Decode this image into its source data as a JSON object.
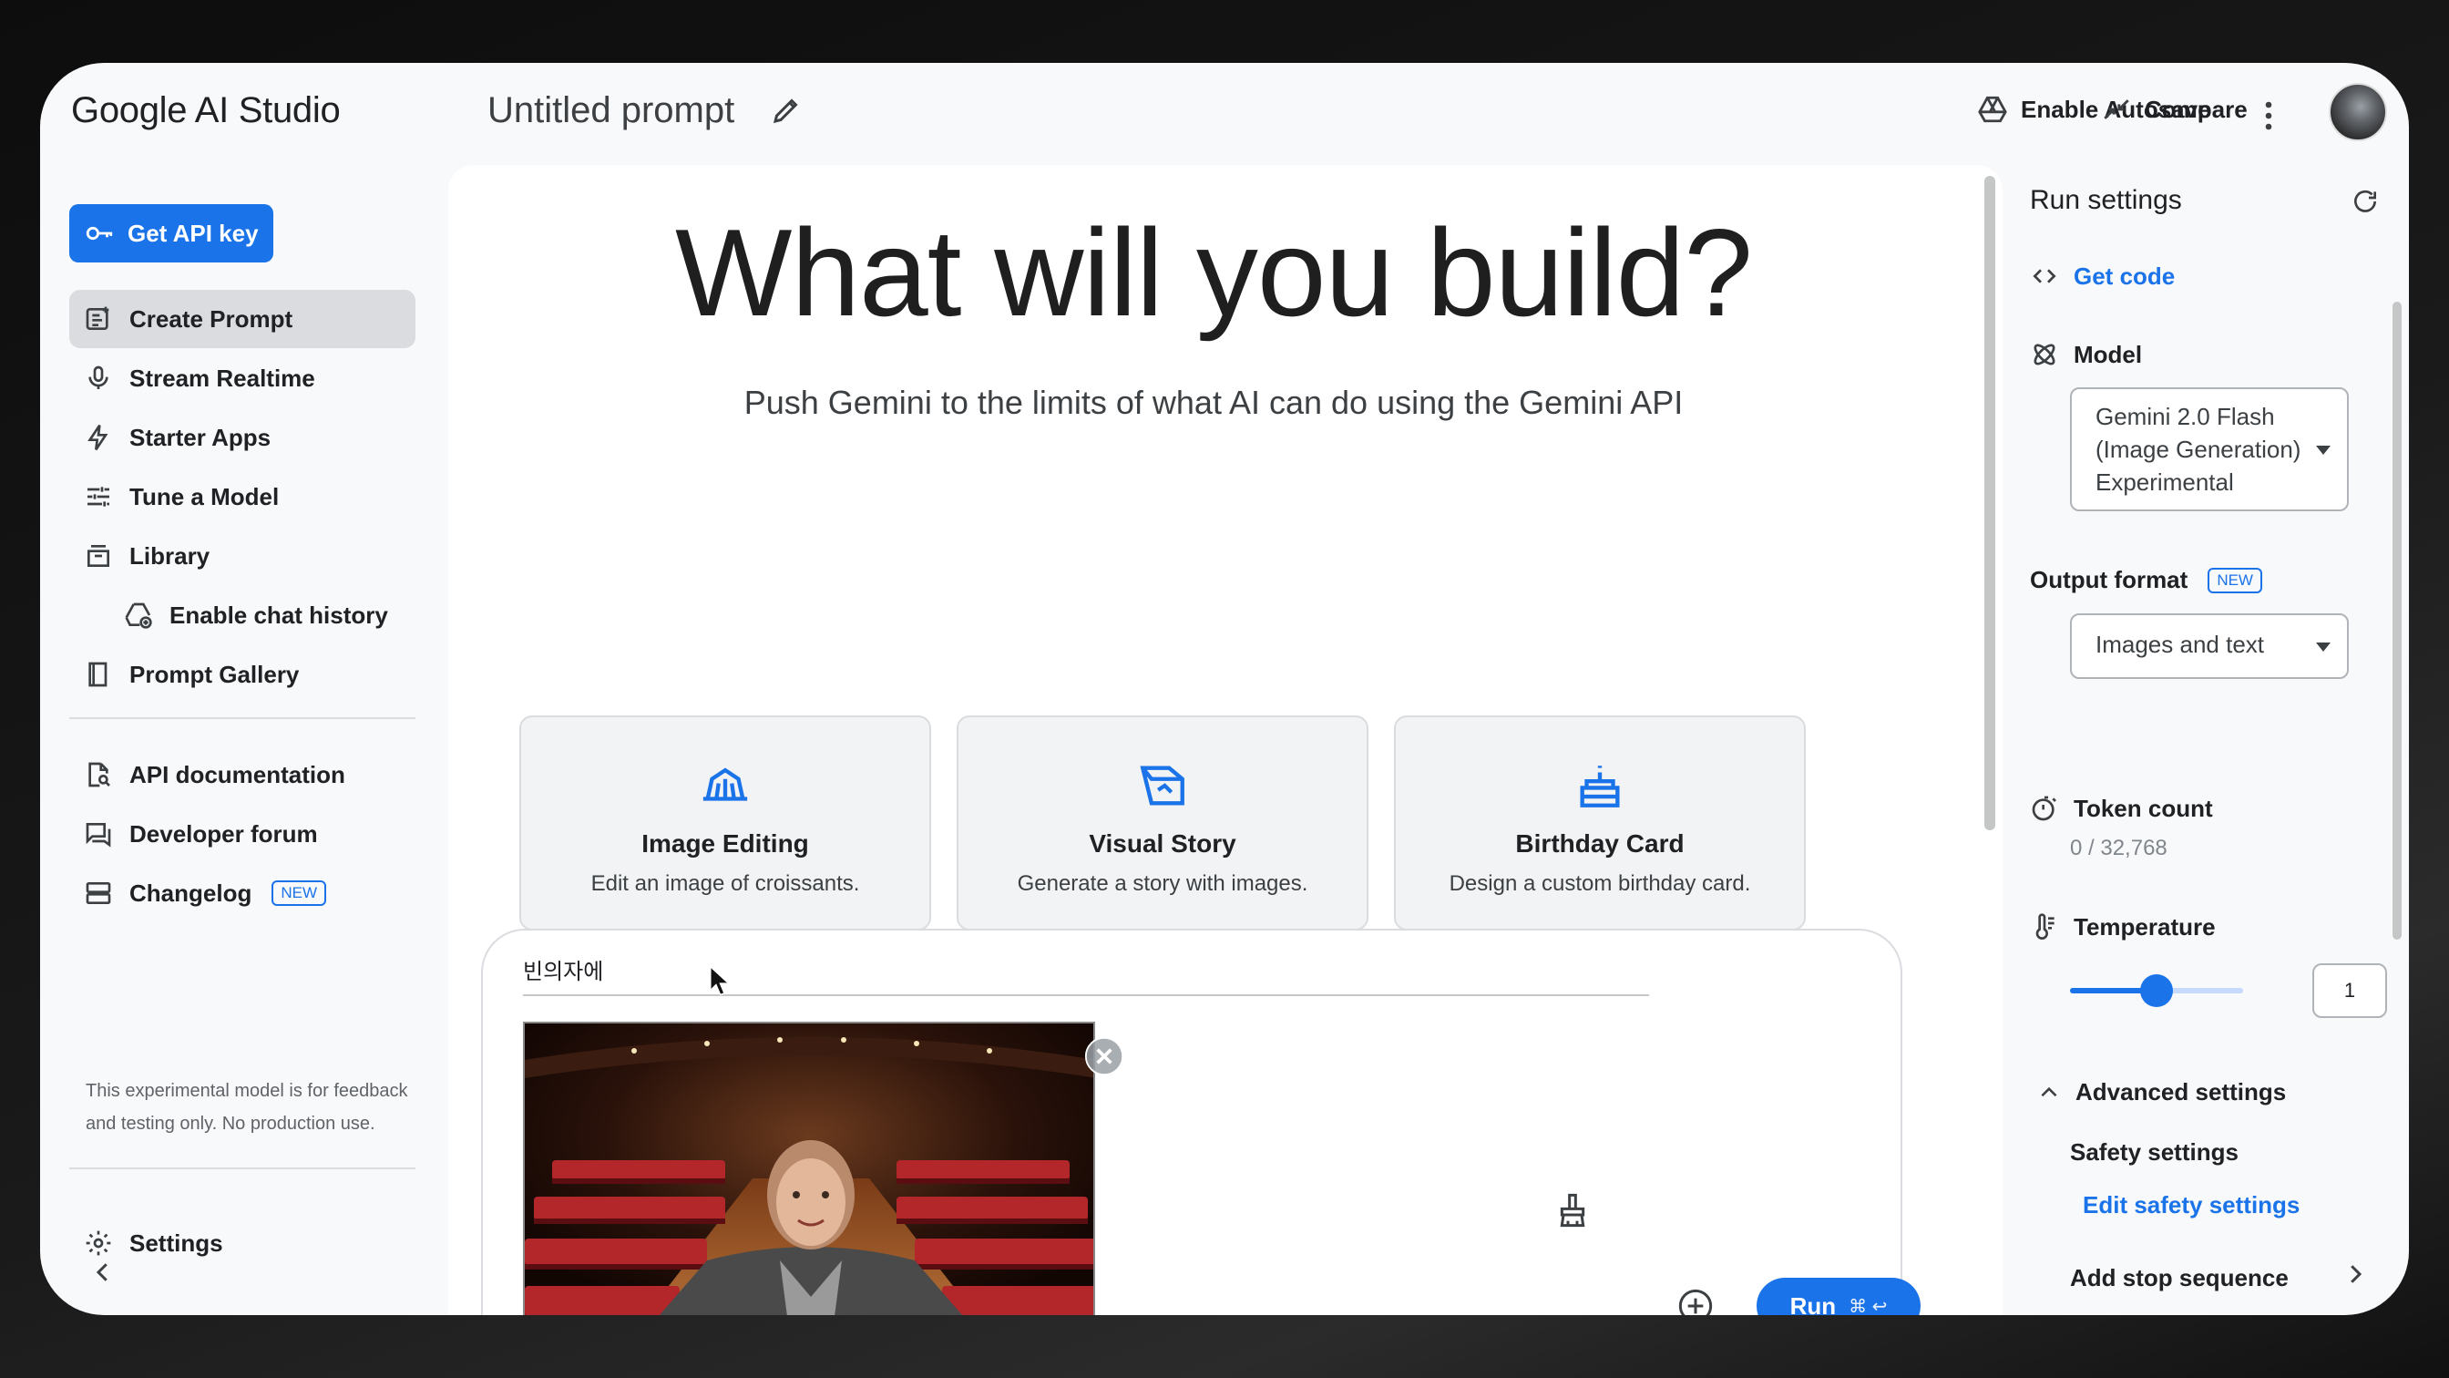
{
  "header": {
    "brand": "Google AI Studio",
    "prompt_title": "Untitled prompt",
    "autosave_label": "Enable Autosave",
    "compare_label": "Compare"
  },
  "sidebar": {
    "api_key_label": "Get API key",
    "items": [
      {
        "label": "Create Prompt"
      },
      {
        "label": "Stream Realtime"
      },
      {
        "label": "Starter Apps"
      },
      {
        "label": "Tune a Model"
      },
      {
        "label": "Library"
      },
      {
        "label": "Enable chat history"
      },
      {
        "label": "Prompt Gallery"
      },
      {
        "label": "API documentation"
      },
      {
        "label": "Developer forum"
      },
      {
        "label": "Changelog",
        "badge": "NEW"
      }
    ],
    "disclaimer": "This experimental model is for feedback and testing only. No production use.",
    "settings_label": "Settings"
  },
  "main": {
    "hero": "What will you build?",
    "subtitle": "Push Gemini to the limits of what AI can do using the Gemini API",
    "cards": [
      {
        "title": "Image Editing",
        "desc": "Edit an image of croissants."
      },
      {
        "title": "Visual Story",
        "desc": "Generate a story with images."
      },
      {
        "title": "Birthday Card",
        "desc": "Design a custom birthday card."
      }
    ],
    "composer": {
      "input_value": "빈의자에",
      "run_label": "Run",
      "run_shortcut": "⌘ ↩"
    }
  },
  "run_settings": {
    "title": "Run settings",
    "get_code": "Get code",
    "model_label": "Model",
    "model_value_lines": [
      "Gemini 2.0 Flash",
      "(Image Generation)",
      "Experimental"
    ],
    "output_format_label": "Output format",
    "output_format_badge": "NEW",
    "output_format_value": "Images and text",
    "token_count_label": "Token count",
    "token_count_value": "0 / 32,768",
    "temperature_label": "Temperature",
    "temperature_value": "1",
    "temperature_fraction": 0.5,
    "advanced_label": "Advanced settings",
    "safety_label": "Safety settings",
    "edit_safety_label": "Edit safety settings",
    "stop_sequence_label": "Add stop sequence"
  },
  "colors": {
    "accent": "#1a73e8",
    "active_nav": "#dadce0",
    "surface": "#f8f9fb"
  }
}
